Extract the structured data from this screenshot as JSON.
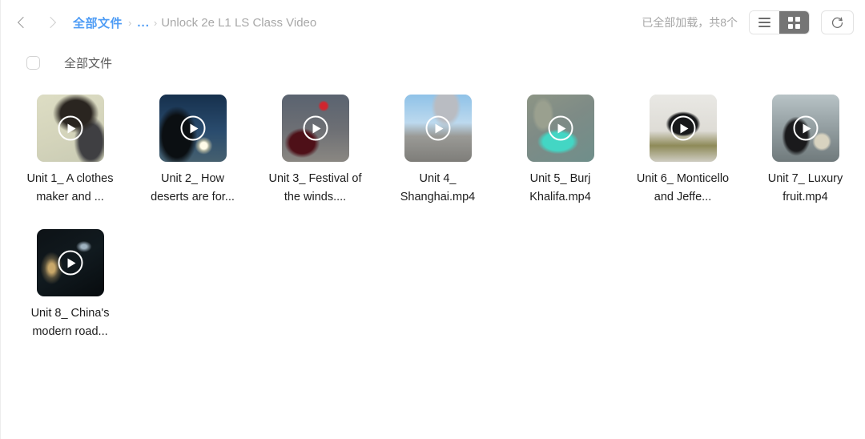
{
  "header": {
    "back_icon": "chevron-left-icon",
    "forward_icon": "chevron-right-icon",
    "breadcrumb": {
      "root": "全部文件",
      "ellipsis": "...",
      "current": "Unlock 2e L1 LS Class Video",
      "separator": "›"
    },
    "status_text": "已全部加载，共8个",
    "view_list_icon": "list-view-icon",
    "view_grid_icon": "grid-view-icon",
    "active_view": "grid",
    "refresh_icon": "refresh-icon"
  },
  "select_all": {
    "checked": false,
    "label": "全部文件"
  },
  "colors": {
    "accent": "#4e9cf5",
    "status_text": "#a6a6a6",
    "breadcrumb_current": "#a8a8a8",
    "toggle_active_bg": "#757575",
    "file_label": "#1d1d1d"
  },
  "files": [
    {
      "name": "Unit 1_ A clothes maker and ...",
      "art": "t1",
      "play_icon": "play-icon"
    },
    {
      "name": "Unit 2_ How deserts are for...",
      "art": "t2",
      "play_icon": "play-icon"
    },
    {
      "name": "Unit 3_ Festival of the winds....",
      "art": "t3",
      "play_icon": "play-icon"
    },
    {
      "name": "Unit 4_ Shanghai.mp4",
      "art": "t4",
      "play_icon": "play-icon"
    },
    {
      "name": "Unit 5_ Burj Khalifa.mp4",
      "art": "t5",
      "play_icon": "play-icon"
    },
    {
      "name": "Unit 6_ Monticello and Jeffe...",
      "art": "t6",
      "play_icon": "play-icon"
    },
    {
      "name": "Unit 7_ Luxury fruit.mp4",
      "art": "t7",
      "play_icon": "play-icon"
    },
    {
      "name": "Unit 8_ China's modern road...",
      "art": "t8",
      "play_icon": "play-icon"
    }
  ]
}
